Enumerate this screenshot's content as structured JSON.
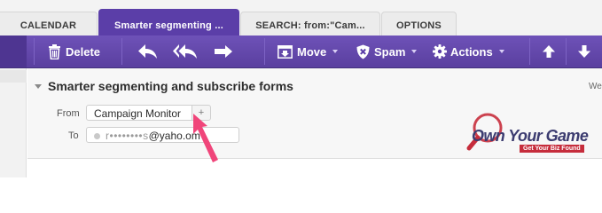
{
  "tabs": [
    {
      "label": "CALENDAR",
      "active": false
    },
    {
      "label": "Smarter segmenting ...",
      "active": true
    },
    {
      "label": "SEARCH: from:\"Cam...",
      "active": false
    },
    {
      "label": "OPTIONS",
      "active": false
    }
  ],
  "toolbar": {
    "delete_label": "Delete",
    "move_label": "Move",
    "spam_label": "Spam",
    "actions_label": "Actions"
  },
  "message": {
    "subject": "Smarter segmenting and subscribe forms",
    "date_fragment": "We",
    "from_label": "From",
    "from_value": "Campaign Monitor",
    "add_contact_glyph": "+",
    "to_label": "To",
    "to_value_masked": "r••••••••s",
    "to_value_domain": "@yaho",
    "to_value_tail": ".om"
  },
  "watermark": {
    "title": "Own Your Game",
    "tagline": "Get Your Biz Found"
  },
  "colors": {
    "toolbar": "#5b3ea8",
    "annotation_arrow": "#f0457a",
    "watermark_red": "#c62d3c",
    "watermark_navy": "#3c3c70"
  },
  "icons": [
    "trash-icon",
    "reply-icon",
    "reply-all-icon",
    "forward-icon",
    "move-to-folder-icon",
    "spam-shield-icon",
    "gear-icon",
    "arrow-up-icon",
    "arrow-down-icon",
    "collapse-triangle-icon",
    "add-contact-icon",
    "annotation-arrow-icon"
  ]
}
